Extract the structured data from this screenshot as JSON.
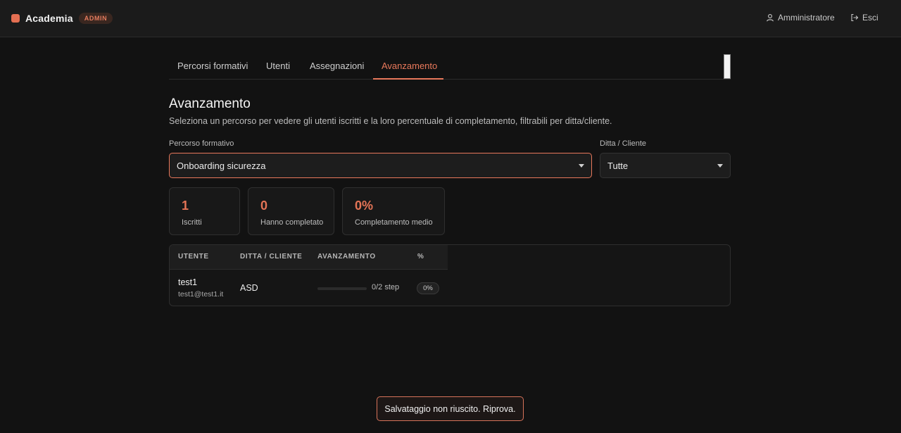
{
  "header": {
    "app_name": "Academia",
    "role_badge": "ADMIN",
    "user_label": "Amministratore",
    "logout_label": "Esci"
  },
  "tabs": [
    {
      "label": "Percorsi formativi"
    },
    {
      "label": "Utenti"
    },
    {
      "label": "Assegnazioni"
    },
    {
      "label": "Avanzamento",
      "active": true
    }
  ],
  "page": {
    "title": "Avanzamento",
    "description": "Seleziona un percorso per vedere gli utenti iscritti e la loro percentuale di completamento, filtrabili per ditta/cliente."
  },
  "filters": {
    "course": {
      "label": "Percorso formativo",
      "value": "Onboarding sicurezza"
    },
    "company": {
      "label": "Ditta / Cliente",
      "value": "Tutte"
    }
  },
  "stats": [
    {
      "value": "1",
      "label": "Iscritti"
    },
    {
      "value": "0",
      "label": "Hanno completato"
    },
    {
      "value": "0%",
      "label": "Completamento medio"
    }
  ],
  "table": {
    "headers": [
      "UTENTE",
      "DITTA / CLIENTE",
      "AVANZAMENTO",
      "%"
    ],
    "rows": [
      {
        "name": "test1",
        "email": "test1@test1.it",
        "company": "ASD",
        "progress_text": "0/2 step",
        "progress_fraction": 0,
        "percent": "0%"
      }
    ]
  },
  "toast": {
    "message": "Salvataggio non riuscito. Riprova."
  },
  "colors": {
    "accent": "#e8785b",
    "background": "#121212",
    "error_border": "#d7735a"
  }
}
